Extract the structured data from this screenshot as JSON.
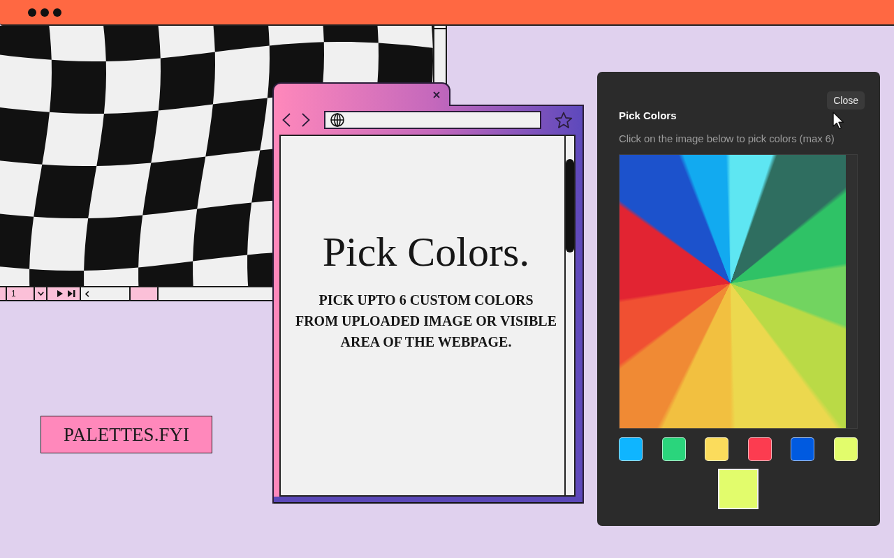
{
  "pattern_window": {
    "page_field": "1"
  },
  "browser_window": {
    "heading": "Pick Colors.",
    "subtitle": "PICK UPTO 6 CUSTOM COLORS\nFROM UPLOADED IMAGE OR VISIBLE\nAREA OF THE WEBPAGE."
  },
  "brand_label": {
    "text": "PALETTES.FYI"
  },
  "picker_panel": {
    "close_button": "Close",
    "title": "Pick Colors",
    "hint": "Click on the image below to pick colors (max 6)",
    "swatches": [
      {
        "color": "#0fb5ff"
      },
      {
        "color": "#2ad57c"
      },
      {
        "color": "#fbdc5c"
      },
      {
        "color": "#fc3c50"
      },
      {
        "color": "#005ae0"
      },
      {
        "color": "#e2fc6c"
      }
    ],
    "preview": {
      "color": "#e2fc6c"
    }
  }
}
